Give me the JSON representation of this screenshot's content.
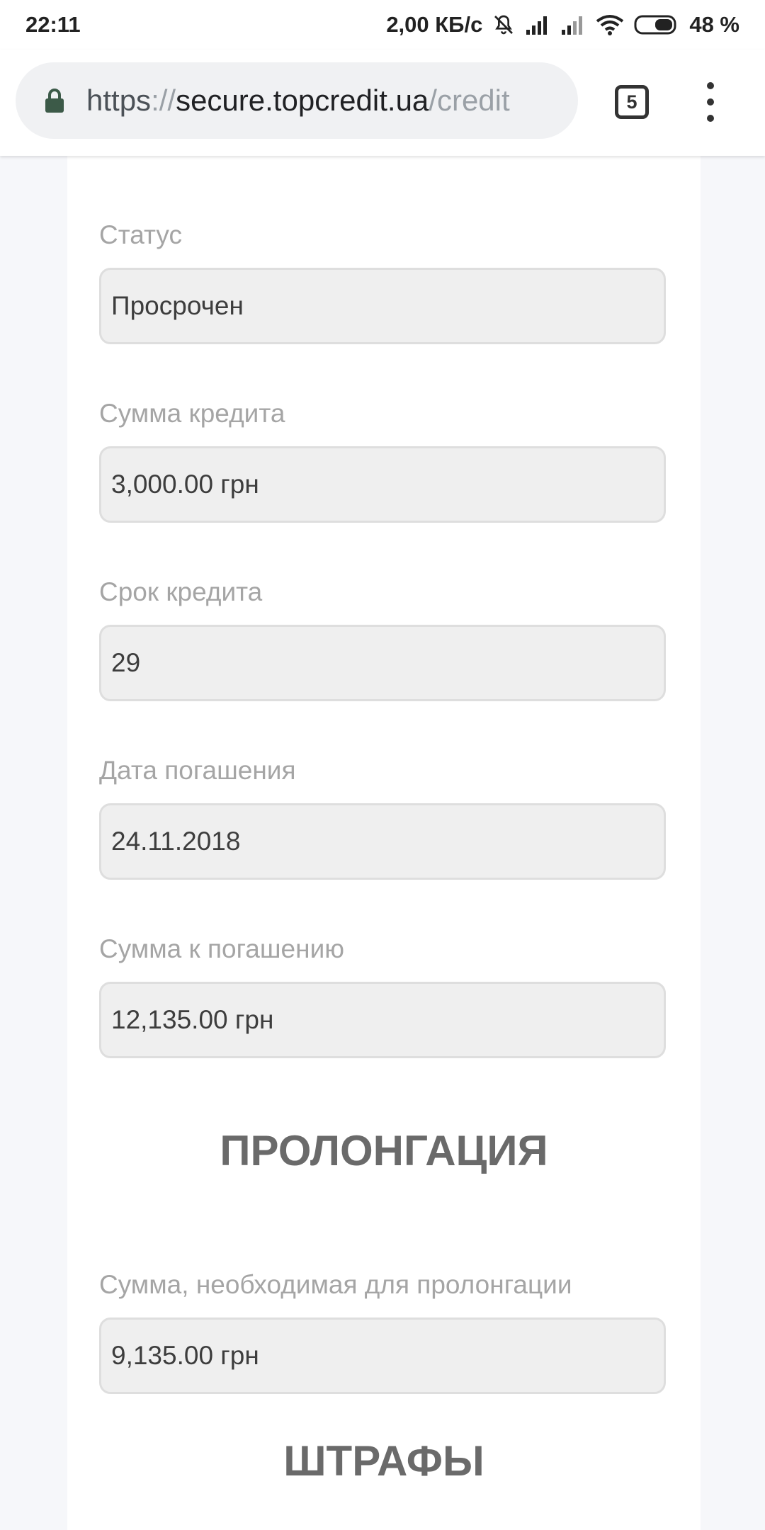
{
  "status_bar": {
    "time": "22:11",
    "network_speed": "2,00 КБ/с",
    "battery": "48 %",
    "icons": [
      "muted-bell-icon",
      "signal-icon",
      "signal-icon",
      "wifi-icon",
      "battery-icon"
    ]
  },
  "browser": {
    "url_scheme": "https",
    "url_separator": "://",
    "url_host": "secure.topcredit.ua",
    "url_path": "/credit",
    "tab_count": "5"
  },
  "fields": [
    {
      "label": "Статус",
      "value": "Просрочен"
    },
    {
      "label": "Сумма кредита",
      "value": "3,000.00 грн"
    },
    {
      "label": "Срок кредита",
      "value": "29"
    },
    {
      "label": "Дата погашения",
      "value": "24.11.2018"
    },
    {
      "label": "Сумма к погашению",
      "value": "12,135.00 грн"
    }
  ],
  "prolongation": {
    "heading": "ПРОЛОНГАЦИЯ",
    "label": "Сумма, необходимая для пролонгации",
    "value": "9,135.00 грн"
  },
  "penalties": {
    "heading": "ШТРАФЫ"
  },
  "colors": {
    "page_background": "#f6f7fa",
    "card_background": "#ffffff",
    "field_background": "#efefef",
    "label_text": "#a5a5a5",
    "heading_text": "#6a6a6a",
    "lock_icon": "#3c5a48"
  }
}
